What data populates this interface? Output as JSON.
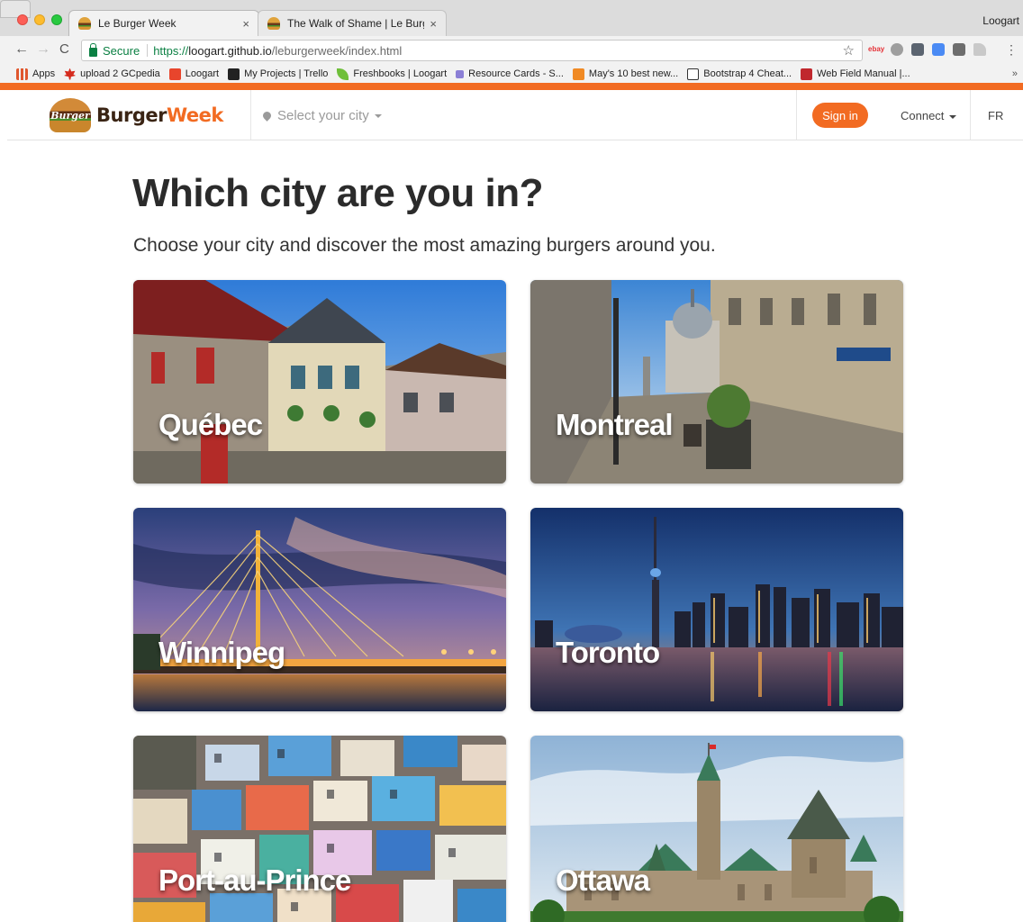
{
  "browser": {
    "tabs": [
      {
        "title": "Le Burger Week",
        "close": "×"
      },
      {
        "title": "The Walk of Shame | Le Burge",
        "close": "×"
      }
    ],
    "profile": "Loogart",
    "address": {
      "secure_label": "Secure",
      "scheme": "https://",
      "host": "loogart.github.io",
      "path": "/leburgerweek/index.html"
    },
    "extensions": [
      "ebay-icon",
      "ghost-icon",
      "pocket-icon",
      "translate-icon",
      "map-icon",
      "drive-icon"
    ],
    "bookmarks": [
      {
        "label": "Apps",
        "icon": "apps-grid-icon",
        "color": "#e0572e"
      },
      {
        "label": "upload 2 GCpedia",
        "icon": "maple-leaf-icon",
        "color": "#d52b1e"
      },
      {
        "label": "Loogart",
        "icon": "loogart-icon",
        "color": "#e8452c"
      },
      {
        "label": "My Projects | Trello",
        "icon": "trello-icon",
        "color": "#222222"
      },
      {
        "label": "Freshbooks | Loogart",
        "icon": "freshbooks-icon",
        "color": "#6fbf3a"
      },
      {
        "label": "Resource Cards - S...",
        "icon": "resource-icon",
        "color": "#8b7fd6"
      },
      {
        "label": "May's 10 best new...",
        "icon": "article-icon",
        "color": "#f08a24"
      },
      {
        "label": "Bootstrap 4 Cheat...",
        "icon": "bootstrap-icon",
        "color": "#333333"
      },
      {
        "label": "Web Field Manual |...",
        "icon": "manual-icon",
        "color": "#c0272d"
      }
    ],
    "bookmarks_more": "»"
  },
  "header": {
    "brand_logo_text": "Burger",
    "brand_part1": "Burger",
    "brand_part2": "Week",
    "city_select": "Select your city",
    "sign_in": "Sign in",
    "connect": "Connect",
    "lang": "FR",
    "accent": "#f26b22"
  },
  "main": {
    "title": "Which city are you in?",
    "subtitle": "Choose your city and discover the most amazing burgers around you.",
    "cities": [
      {
        "name": "Québec"
      },
      {
        "name": "Montreal"
      },
      {
        "name": "Winnipeg"
      },
      {
        "name": "Toronto"
      },
      {
        "name": "Port-au-Prince"
      },
      {
        "name": "Ottawa"
      }
    ]
  }
}
